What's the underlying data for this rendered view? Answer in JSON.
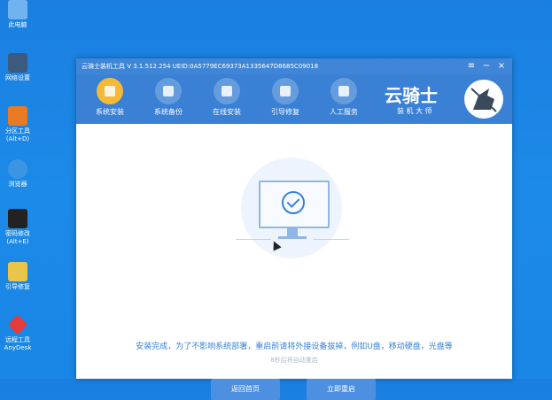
{
  "desktop_icons": [
    {
      "label": "此电脑"
    },
    {
      "label": "网络设置"
    },
    {
      "label": "分区工具\n(Alt+D)"
    },
    {
      "label": "浏览器"
    },
    {
      "label": "密码修改\n(Alt+E)"
    },
    {
      "label": "引导修复"
    },
    {
      "label": "远程工具\nAnyDesk"
    }
  ],
  "window": {
    "title": "云骑士装机工具 V 3.1.512.254 UEID:0A5779EC69373A1335647D8685C09018",
    "controls": [
      "≡",
      "−",
      "×"
    ]
  },
  "toolbar": [
    {
      "label": "系统安装",
      "active": true
    },
    {
      "label": "系统备份",
      "active": false
    },
    {
      "label": "在线安装",
      "active": false
    },
    {
      "label": "引导修复",
      "active": false
    },
    {
      "label": "人工服务",
      "active": false
    }
  ],
  "logo": {
    "name": "云骑士",
    "slogan": "装 机 大 师"
  },
  "content": {
    "message": "安装完成，为了不影响系统部署，重启前请将外接设备拔掉，例如U盘，移动硬盘，光盘等",
    "countdown": "8秒后将自动重启",
    "btn_back": "返回首页",
    "btn_restart": "立即重启"
  }
}
